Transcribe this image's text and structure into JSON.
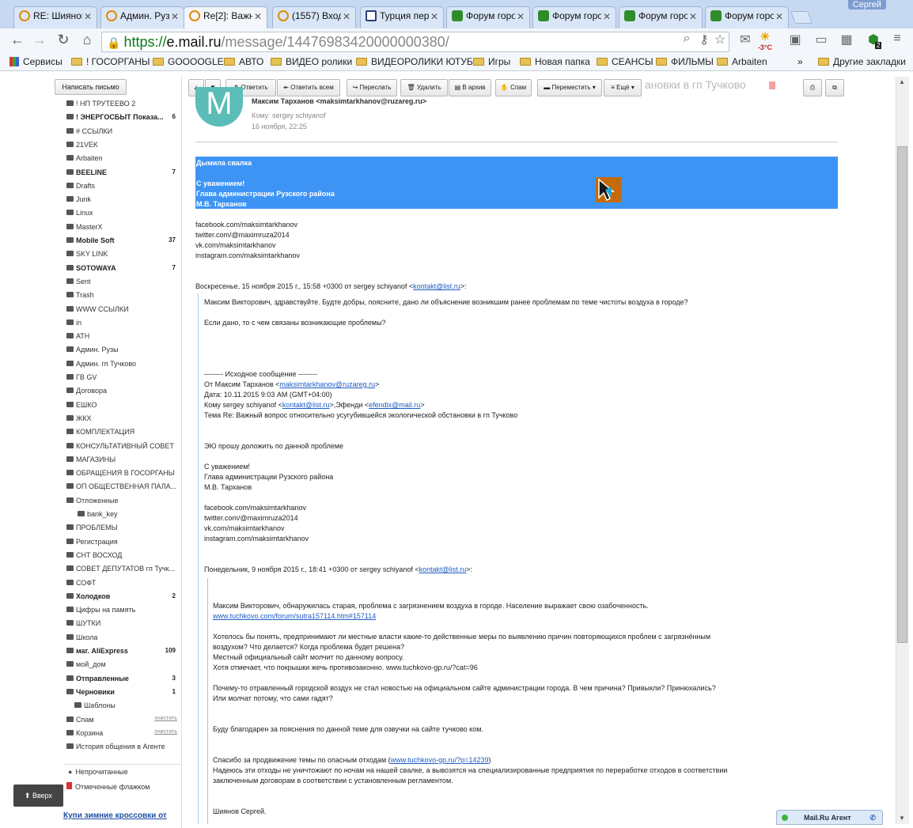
{
  "browser": {
    "tabs": [
      {
        "title": "RE: Шиянов",
        "icon": "mailru-icon"
      },
      {
        "title": "Админ. Рузск",
        "icon": "mailru-icon"
      },
      {
        "title": "Re[2]: Важный",
        "icon": "mailru-icon"
      },
      {
        "title": "(1557) Входящ",
        "icon": "mailru-icon"
      },
      {
        "title": "Турция пер",
        "icon": "document-icon"
      },
      {
        "title": "Форум горо",
        "icon": "shield-icon"
      },
      {
        "title": "Форум горо",
        "icon": "shield-icon"
      },
      {
        "title": "Форум горо",
        "icon": "shield-icon"
      },
      {
        "title": "Форум горо",
        "icon": "shield-icon"
      }
    ],
    "user": "Сергей",
    "url_scheme": "https://",
    "url_host": "e.mail.ru",
    "url_path": "/message/14476983420000000380/",
    "weather": "-3°C",
    "badge_count": "2",
    "bookmarks": [
      "Сервисы",
      "! ГОСОРГАНЫ",
      "GOOOOGLE",
      "АВТО",
      "ВИДЕО ролики",
      "ВИДЕОРОЛИКИ ЮТУБЕ",
      "Игры",
      "Новая папка",
      "СЕАНСЫ",
      "ФИЛЬМЫ",
      "Arbaiten"
    ],
    "bookmarks_more": "»",
    "other_bookmarks": "Другие закладки"
  },
  "sidebar": {
    "compose": "Написать письмо",
    "folders": [
      {
        "label": "! НП ТРУТЕЕВО 2",
        "bold": false,
        "count": ""
      },
      {
        "label": "! ЭНЕРГОСБЫТ Показа...",
        "bold": true,
        "count": "6"
      },
      {
        "label": "# ССЫЛКИ",
        "bold": false,
        "count": ""
      },
      {
        "label": "21VEK",
        "bold": false,
        "count": ""
      },
      {
        "label": "Arbaiten",
        "bold": false,
        "count": ""
      },
      {
        "label": "BEELINE",
        "bold": true,
        "count": "7"
      },
      {
        "label": "Drafts",
        "bold": false,
        "count": ""
      },
      {
        "label": "Junk",
        "bold": false,
        "count": ""
      },
      {
        "label": "Linux",
        "bold": false,
        "count": ""
      },
      {
        "label": "MasterX",
        "bold": false,
        "count": ""
      },
      {
        "label": "Mobile Soft",
        "bold": true,
        "count": "37"
      },
      {
        "label": "SKY LINK",
        "bold": false,
        "count": ""
      },
      {
        "label": "SOTOWAYA",
        "bold": true,
        "count": "7"
      },
      {
        "label": "Sent",
        "bold": false,
        "count": ""
      },
      {
        "label": "Trash",
        "bold": false,
        "count": ""
      },
      {
        "label": "WWW ССЫЛКИ",
        "bold": false,
        "count": ""
      },
      {
        "label": "in",
        "bold": false,
        "count": ""
      },
      {
        "label": "АТН",
        "bold": false,
        "count": ""
      },
      {
        "label": "Админ. Рузы",
        "bold": false,
        "count": ""
      },
      {
        "label": "Админ. гп Тучково",
        "bold": false,
        "count": ""
      },
      {
        "label": "ГВ GV",
        "bold": false,
        "count": ""
      },
      {
        "label": "Договора",
        "bold": false,
        "count": ""
      },
      {
        "label": "ЕШКО",
        "bold": false,
        "count": ""
      },
      {
        "label": "ЖКХ",
        "bold": false,
        "count": ""
      },
      {
        "label": "КОМПЛЕКТАЦИЯ",
        "bold": false,
        "count": ""
      },
      {
        "label": "КОНСУЛЬТАТИВНЫЙ СОВЕТ",
        "bold": false,
        "count": ""
      },
      {
        "label": "МАГАЗИНЫ",
        "bold": false,
        "count": ""
      },
      {
        "label": "ОБРАЩЕНИЯ В ГОСОРГАНЫ",
        "bold": false,
        "count": ""
      },
      {
        "label": "ОП ОБЩЕСТВЕННАЯ ПАЛА...",
        "bold": false,
        "count": ""
      },
      {
        "label": "Отложенные",
        "bold": false,
        "count": ""
      },
      {
        "label": "bank_key",
        "bold": false,
        "count": ""
      },
      {
        "label": "ПРОБЛЕМЫ",
        "bold": false,
        "count": ""
      },
      {
        "label": "Регистрация",
        "bold": false,
        "count": ""
      },
      {
        "label": "СНТ ВОСХОД",
        "bold": false,
        "count": ""
      },
      {
        "label": "СОВЕТ ДЕПУТАТОВ гп Тучк...",
        "bold": false,
        "count": ""
      },
      {
        "label": "СОФТ",
        "bold": false,
        "count": ""
      },
      {
        "label": "Холодков",
        "bold": true,
        "count": "2"
      },
      {
        "label": "Цифры на память",
        "bold": false,
        "count": ""
      },
      {
        "label": "ШУТКИ",
        "bold": false,
        "count": ""
      },
      {
        "label": "Школа",
        "bold": false,
        "count": ""
      },
      {
        "label": "маг. AliExpress",
        "bold": true,
        "count": "109"
      },
      {
        "label": "мой_дом",
        "bold": false,
        "count": ""
      },
      {
        "label": "Отправленные",
        "bold": true,
        "count": "3"
      },
      {
        "label": "Черновики",
        "bold": true,
        "count": "1"
      },
      {
        "label": "Шаблоны",
        "bold": false,
        "count": ""
      },
      {
        "label": "Спам",
        "bold": false,
        "count": ""
      },
      {
        "label": "Корзина",
        "bold": false,
        "count": ""
      },
      {
        "label": "История общения в Агенте",
        "bold": false,
        "count": ""
      }
    ],
    "clear_label": "очистить",
    "unread": "Непрочитанные",
    "flagged": "Отмеченные флажком",
    "to_top": "Вверх",
    "ad": "Купи зимние кроссовки от"
  },
  "msg_toolbar": {
    "reply": "Ответить",
    "reply_all": "Ответить всем",
    "forward": "Переслать",
    "delete": "Удалить",
    "archive": "В архив",
    "spam": "Спам",
    "move": "Переместить",
    "more": "Ещё",
    "subject_tail": "ановки в гп Тучково"
  },
  "message": {
    "avatar_letter": "M",
    "from": "Максим Тарханов <maksimtarkhanov@ruzareg.ru>",
    "to": "Кому: sergey schiyanof",
    "date": "16 ноября, 22:25",
    "highlight": [
      "Дымила свалка",
      "",
      "С уважением!",
      "Глава администрации Рузского района",
      "М.В. Тарханов"
    ],
    "links1": [
      "facebook.com/maksimtarkhanov",
      "twitter.com/@maximruza2014",
      "vk.com/maksimtarkhanov",
      "instagram.com/maksimtarkhanov"
    ],
    "quote1_head": "Воскресенье, 15 ноября 2015 г., 15:58 +0300 от sergey schiyanof <",
    "quote1_email": "kontakt@list.ru",
    "quote1_tail": ">:",
    "q1_p1": "Максим Викторович, здравствуйте. Будте добры, поясните,  дано ли объяснение возникшим ранее проблемам по теме чистоты воздуха в городе?",
    "q1_p2": "Если дано, то с чем связаны возникающие проблемы?",
    "orig_header": "-------- Исходное сообщение --------",
    "orig_from_pre": "От Максим Тарханов <",
    "orig_from_email": "maksimtarkhanov@ruzareg.ru",
    "orig_from_post": ">",
    "orig_date": "Дата: 10.11.2015 9:03 AM (GMT+04:00)",
    "orig_to_pre": "Кому sergey schiyanof <",
    "orig_to_email1": "kontakt@list.ru",
    "orig_to_mid": ">,Эфенди <",
    "orig_to_email2": "efendix@mail.ru",
    "orig_to_post": ">",
    "orig_subject": "Тема Re: Важный вопрос относительно усугубившейся экологической обстановки в гп Тучково",
    "orig_body": "ЭЮ прошу доложить по данной проблеме",
    "orig_sign": [
      "С уважением!",
      "Глава администрации Рузского района",
      "М.В. Тарханов"
    ],
    "links2": [
      "facebook.com/maksimtarkhanov",
      "twitter.com/@maximruza2014",
      "vk.com/maksimtarkhanov",
      "instagram.com/maksimtarkhanov"
    ],
    "quote2_head": "Понедельник, 9 ноября 2015 г., 18:41 +0300 от sergey schiyanof <",
    "quote2_email": "kontakt@list.ru",
    "quote2_tail": ">:",
    "q2_l1": "Максим Викторович,  обнаружилась старая, проблема с загрязнением воздуха в городе. Население выражает свою озабоченность.",
    "q2_link1": "www.tuchkovo.com/forum/sutra157114.htm#157114",
    "q2_l2": "Хотелось бы понять, предпринимают ли местные власти какие-то действенные меры по выявлению причин  повторяющихся проблем с загрязнённым",
    "q2_l3": "воздухом? Что делается? Когда проблема будет решена?",
    "q2_l4": "Местный официальный сайт молчит по данному вопросу.",
    "q2_l5": "Хотя отмечает, что покрышки жечь противозаконно. www.tuchkovo-gp.ru/?cat=96",
    "q2_l6": "Почему-то отравленный  городской воздух не стал новостью на официальном сайте администрации города. В чем причина? Привыкли? Принюхались?",
    "q2_l7": "Или молчат потому, что сами гадят?",
    "q2_l8": "Буду благодарен за пояснения по данной теме для озвучки на сайте тучково ком.",
    "q2_l9_pre": "Спасибо за продвижение темы по опасным отходам (",
    "q2_l9_link": "www.tuchkovo-gp.ru/?p=14239",
    "q2_l9_post": ")",
    "q2_l10": "Надеюсь эти отходы не уничтожают по ночам на нашей свалке, а вывозятся на специализированные предприятия по переработке отходов  в соответствии",
    "q2_l11": "заключенным договорам в соответствии с установленным регламентом.",
    "q2_sign": "Шиянов Сергей."
  },
  "agent": {
    "label": "Mail.Ru Агент"
  }
}
